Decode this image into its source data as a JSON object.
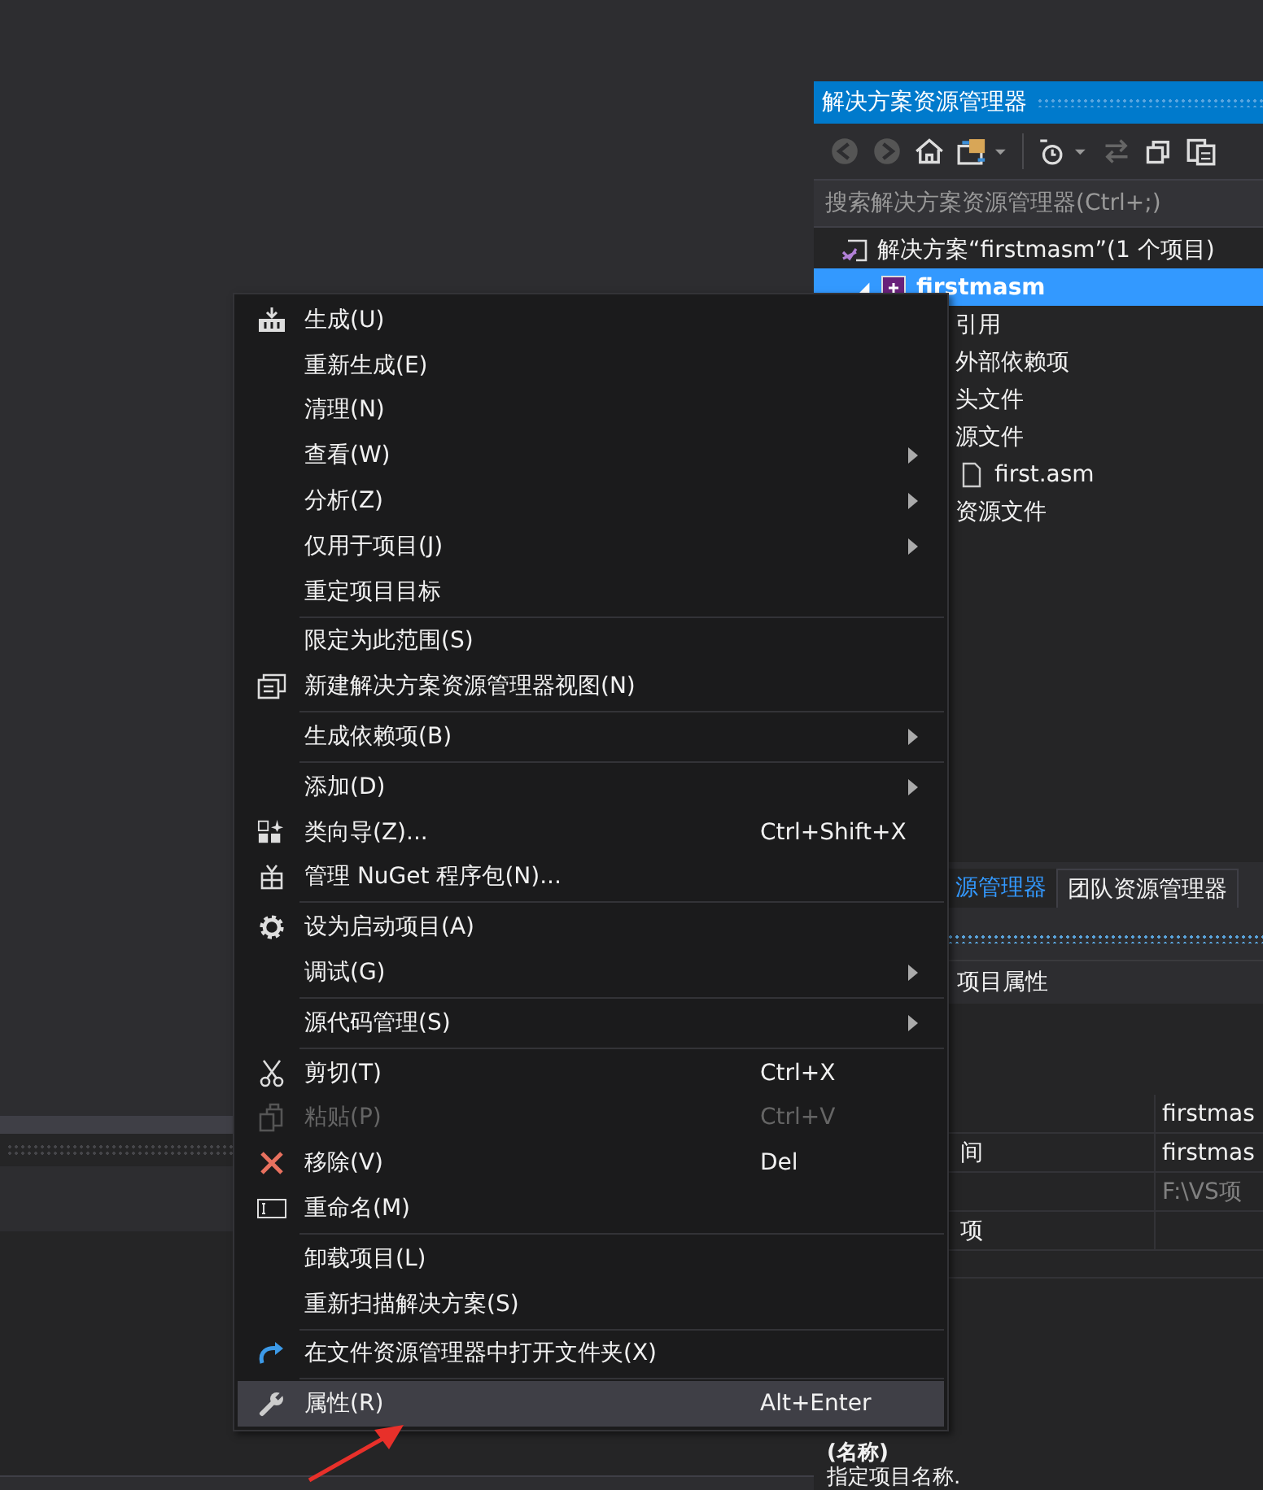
{
  "solution_explorer": {
    "title": "解决方案资源管理器",
    "search": {
      "placeholder": "搜索解决方案资源管理器(Ctrl+;)"
    },
    "tree": [
      {
        "label": "解决方案“firstmasm”(1 个项目)",
        "kind": "solution",
        "selected": false,
        "children": [
          {
            "label": "firstmasm",
            "kind": "project",
            "selected": true,
            "expanded": true,
            "children": [
              {
                "label": "引用",
                "selected": false
              },
              {
                "label": "外部依赖项",
                "selected": false
              },
              {
                "label": "头文件",
                "selected": false
              },
              {
                "label": "源文件",
                "selected": false,
                "children": [
                  {
                    "label": "first.asm",
                    "kind": "file",
                    "selected": false
                  }
                ]
              },
              {
                "label": "资源文件",
                "selected": false
              }
            ]
          }
        ]
      }
    ]
  },
  "context_menu": {
    "groups": [
      {
        "items": [
          {
            "label": "生成(U)",
            "has_submenu": false,
            "disabled": false,
            "selected": false
          },
          {
            "label": "重新生成(E)",
            "has_submenu": false,
            "disabled": false,
            "selected": false
          },
          {
            "label": "清理(N)",
            "has_submenu": false,
            "disabled": false,
            "selected": false
          },
          {
            "label": "查看(W)",
            "has_submenu": true,
            "disabled": false,
            "selected": false
          },
          {
            "label": "分析(Z)",
            "has_submenu": true,
            "disabled": false,
            "selected": false
          },
          {
            "label": "仅用于项目(J)",
            "has_submenu": true,
            "disabled": false,
            "selected": false
          },
          {
            "label": "重定项目目标",
            "has_submenu": false,
            "disabled": false,
            "selected": false
          }
        ]
      },
      {
        "items": [
          {
            "label": "限定为此范围(S)",
            "has_submenu": false,
            "disabled": false,
            "selected": false
          },
          {
            "label": "新建解决方案资源管理器视图(N)",
            "has_submenu": false,
            "disabled": false,
            "selected": false
          }
        ]
      },
      {
        "items": [
          {
            "label": "生成依赖项(B)",
            "has_submenu": true,
            "disabled": false,
            "selected": false
          }
        ]
      },
      {
        "items": [
          {
            "label": "添加(D)",
            "has_submenu": true,
            "disabled": false,
            "selected": false
          },
          {
            "label": "类向导(Z)...",
            "shortcut": "Ctrl+Shift+X",
            "has_submenu": false,
            "disabled": false,
            "selected": false
          },
          {
            "label": "管理 NuGet 程序包(N)...",
            "has_submenu": false,
            "disabled": false,
            "selected": false
          }
        ]
      },
      {
        "items": [
          {
            "label": "设为启动项目(A)",
            "has_submenu": false,
            "disabled": false,
            "selected": false
          },
          {
            "label": "调试(G)",
            "has_submenu": true,
            "disabled": false,
            "selected": false
          }
        ]
      },
      {
        "items": [
          {
            "label": "源代码管理(S)",
            "has_submenu": true,
            "disabled": false,
            "selected": false
          }
        ]
      },
      {
        "items": [
          {
            "label": "剪切(T)",
            "shortcut": "Ctrl+X",
            "has_submenu": false,
            "disabled": false,
            "selected": false
          },
          {
            "label": "粘贴(P)",
            "shortcut": "Ctrl+V",
            "has_submenu": false,
            "disabled": true,
            "selected": false
          },
          {
            "label": "移除(V)",
            "shortcut": "Del",
            "has_submenu": false,
            "disabled": false,
            "selected": false
          },
          {
            "label": "重命名(M)",
            "has_submenu": false,
            "disabled": false,
            "selected": false
          }
        ]
      },
      {
        "items": [
          {
            "label": "卸载项目(L)",
            "has_submenu": false,
            "disabled": false,
            "selected": false
          },
          {
            "label": "重新扫描解决方案(S)",
            "has_submenu": false,
            "disabled": false,
            "selected": false
          }
        ]
      },
      {
        "items": [
          {
            "label": "在文件资源管理器中打开文件夹(X)",
            "has_submenu": false,
            "disabled": false,
            "selected": false
          }
        ]
      },
      {
        "items": [
          {
            "label": "属性(R)",
            "shortcut": "Alt+Enter",
            "has_submenu": false,
            "disabled": false,
            "selected": true
          }
        ]
      }
    ]
  },
  "tabs": [
    {
      "label": "源管理器",
      "selected": true
    },
    {
      "label": "团队资源管理器",
      "selected": false
    }
  ],
  "properties": {
    "header": "项目属性",
    "rows": [
      {
        "value": "firstmas",
        "disabled": false
      },
      {
        "name": "间",
        "value": "firstmas",
        "disabled": false
      },
      {
        "value": "F:\\VS项",
        "disabled": true
      },
      {
        "name": "项",
        "disabled": false
      }
    ],
    "description": {
      "title": "(名称)",
      "text": "指定项目名称."
    }
  }
}
